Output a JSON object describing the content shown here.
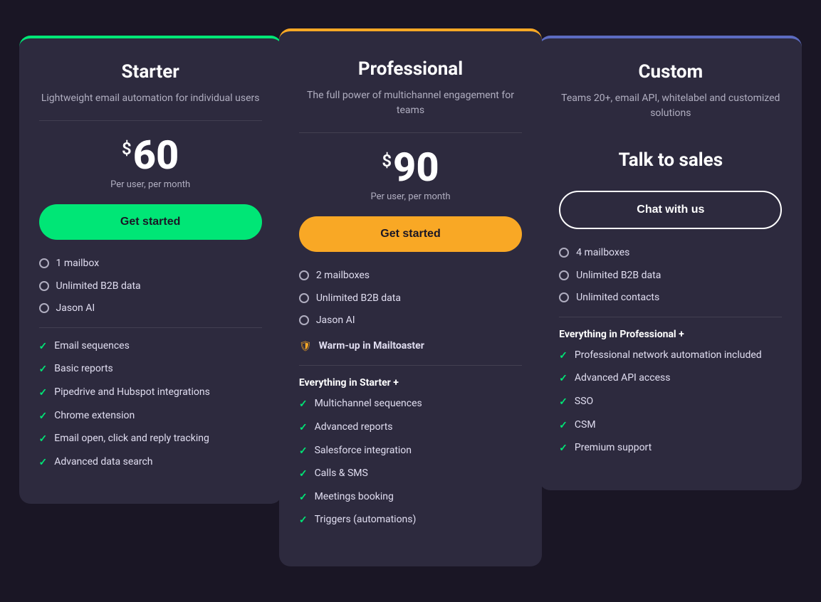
{
  "plans": {
    "starter": {
      "title": "Starter",
      "description": "Lightweight email automation for individual users",
      "price": "60",
      "price_period": "Per user, per month",
      "button_label": "Get started",
      "border_color": "#00e676",
      "button_class": "btn-green",
      "core_features": [
        "1 mailbox",
        "Unlimited B2B data",
        "Jason AI"
      ],
      "check_features": [
        "Email sequences",
        "Basic reports",
        "Pipedrive and Hubspot integrations",
        "Chrome extension",
        "Email open, click and reply tracking",
        "Advanced data search"
      ]
    },
    "professional": {
      "title": "Professional",
      "description": "The full power of multichannel engagement for teams",
      "price": "90",
      "price_period": "Per user, per month",
      "button_label": "Get started",
      "border_color": "#f9a825",
      "button_class": "btn-orange",
      "core_features": [
        "2 mailboxes",
        "Unlimited B2B data",
        "Jason AI"
      ],
      "warm_up_label": "Warm-up in Mailtoaster",
      "everything_label": "Everything in Starter +",
      "check_features": [
        "Multichannel sequences",
        "Advanced reports",
        "Salesforce integration",
        "Calls & SMS",
        "Meetings booking",
        "Triggers (automations)"
      ]
    },
    "custom": {
      "title": "Custom",
      "description": "Teams 20+, email API, whitelabel and customized solutions",
      "talk_to_sales": "Talk to sales",
      "button_label": "Chat with us",
      "border_color": "#5c6bc0",
      "button_class": "btn-outline",
      "core_features": [
        "4 mailboxes",
        "Unlimited B2B data",
        "Unlimited contacts"
      ],
      "everything_label": "Everything in Professional +",
      "check_features": [
        "Professional network automation included",
        "Advanced API access",
        "SSO",
        "CSM",
        "Premium support"
      ]
    }
  }
}
